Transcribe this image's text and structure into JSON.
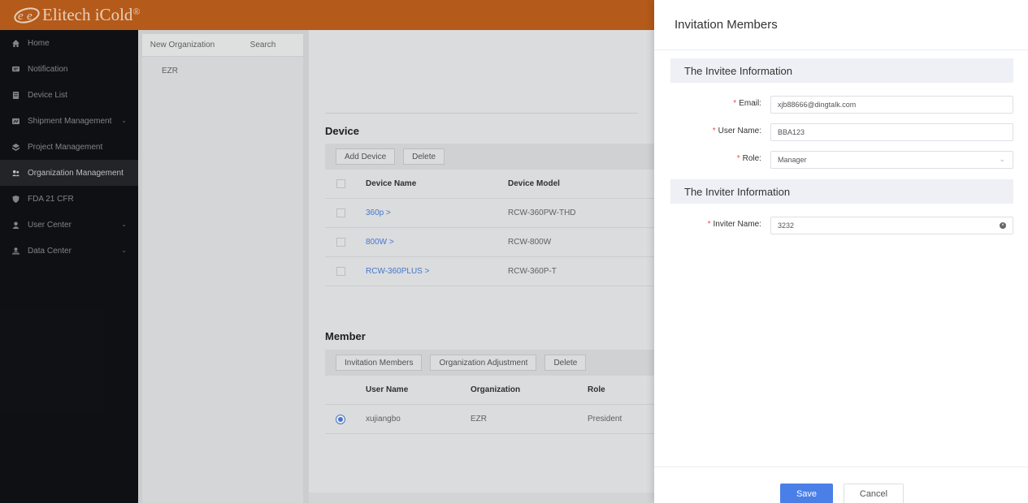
{
  "brand": {
    "name": "Elitech iCold",
    "trademark": "®"
  },
  "sidebar": {
    "items": [
      {
        "label": "Home",
        "icon": "home-icon"
      },
      {
        "label": "Notification",
        "icon": "notification-icon"
      },
      {
        "label": "Device List",
        "icon": "device-list-icon"
      },
      {
        "label": "Shipment Management",
        "icon": "shipment-icon",
        "expandable": true
      },
      {
        "label": "Project Management",
        "icon": "project-icon"
      },
      {
        "label": "Organization Management",
        "icon": "organization-icon",
        "active": true
      },
      {
        "label": "FDA 21 CFR",
        "icon": "shield-icon"
      },
      {
        "label": "User Center",
        "icon": "user-icon",
        "expandable": true
      },
      {
        "label": "Data Center",
        "icon": "data-center-icon",
        "expandable": true
      }
    ]
  },
  "org_panel": {
    "new_org_label": "New Organization",
    "search_label": "Search",
    "organizations": [
      "EZR"
    ]
  },
  "device_section": {
    "title": "Device",
    "add_label": "Add Device",
    "delete_label": "Delete",
    "columns": [
      "Device Name",
      "Device Model"
    ],
    "rows": [
      {
        "name": "360p >",
        "model": "RCW-360PW-THD"
      },
      {
        "name": "800W >",
        "model": "RCW-800W"
      },
      {
        "name": "RCW-360PLUS >",
        "model": "RCW-360P-T"
      }
    ]
  },
  "member_section": {
    "title": "Member",
    "invite_label": "Invitation Members",
    "adjust_label": "Organization Adjustment",
    "delete_label": "Delete",
    "columns": [
      "User Name",
      "Organization",
      "Role"
    ],
    "rows": [
      {
        "user": "xujiangbo",
        "organization": "EZR",
        "role": "President",
        "selected": true
      }
    ]
  },
  "drawer": {
    "title": "Invitation Members",
    "invitee_heading": "The Invitee Information",
    "inviter_heading": "The Inviter Information",
    "fields": {
      "email": {
        "label": "Email:",
        "value": "xjb88666@dingtalk.com"
      },
      "username": {
        "label": "User Name:",
        "value": "BBA123"
      },
      "role": {
        "label": "Role:",
        "value": "Manager"
      },
      "inviter": {
        "label": "Inviter Name:",
        "value": "3232"
      }
    },
    "required_mark": "*",
    "save_label": "Save",
    "cancel_label": "Cancel"
  },
  "colors": {
    "topbar": "#c0601c",
    "sidebar": "#101215",
    "accent": "#4a7fe8",
    "required": "#f04a4a"
  }
}
